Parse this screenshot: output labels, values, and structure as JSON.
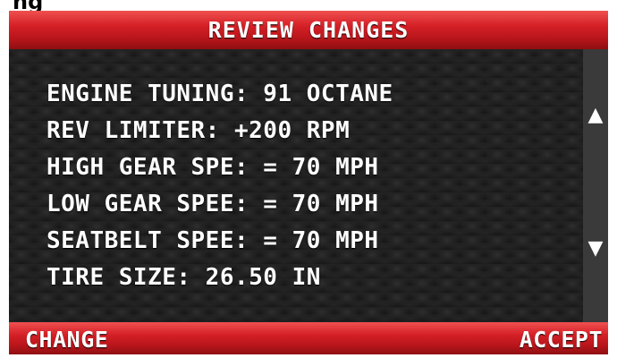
{
  "cropped_heading": "ng",
  "header": {
    "title": "REVIEW CHANGES"
  },
  "settings": [
    {
      "label": "ENGINE TUNING: 91 OCTANE"
    },
    {
      "label": "REV LIMITER: +200 RPM"
    },
    {
      "label": "HIGH GEAR SPE: = 70 MPH"
    },
    {
      "label": "LOW GEAR SPEE: = 70 MPH"
    },
    {
      "label": "SEATBELT SPEE: = 70 MPH"
    },
    {
      "label": "TIRE SIZE: 26.50 IN"
    }
  ],
  "scroll": {
    "up_icon": "▲",
    "down_icon": "▼"
  },
  "footer": {
    "left_label": "CHANGE",
    "right_label": "ACCEPT"
  },
  "colors": {
    "accent": "#d41f26",
    "background": "#111111",
    "text": "#ffffff"
  }
}
